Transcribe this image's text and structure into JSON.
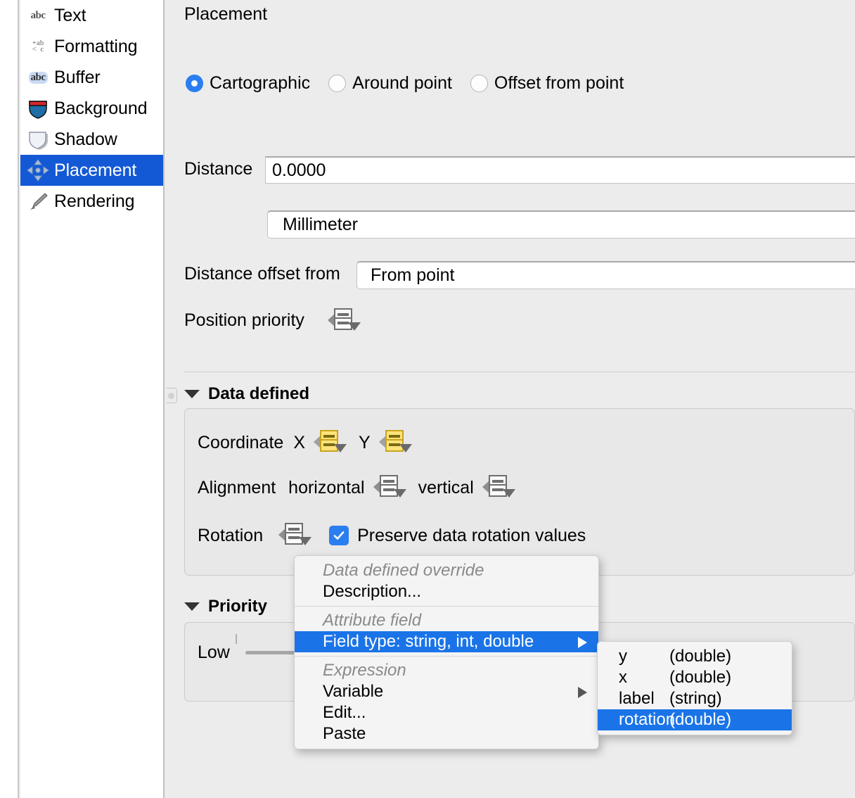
{
  "sidebar": {
    "items": [
      {
        "label": "Text",
        "icon": "abc-text-icon",
        "selected": false
      },
      {
        "label": "Formatting",
        "icon": "formatting-icon",
        "selected": false
      },
      {
        "label": "Buffer",
        "icon": "abc-buffer-icon",
        "selected": false
      },
      {
        "label": "Background",
        "icon": "background-icon",
        "selected": false
      },
      {
        "label": "Shadow",
        "icon": "shadow-icon",
        "selected": false
      },
      {
        "label": "Placement",
        "icon": "placement-icon",
        "selected": true
      },
      {
        "label": "Rendering",
        "icon": "rendering-icon",
        "selected": false
      }
    ]
  },
  "panel": {
    "title": "Placement",
    "placement_modes": [
      {
        "label": "Cartographic",
        "checked": true
      },
      {
        "label": "Around point",
        "checked": false
      },
      {
        "label": "Offset from point",
        "checked": false
      }
    ],
    "distance": {
      "label": "Distance",
      "value": "0.0000"
    },
    "units": {
      "value": "Millimeter"
    },
    "distance_offset_from": {
      "label": "Distance offset from",
      "value": "From point"
    },
    "position_priority": {
      "label": "Position priority"
    }
  },
  "data_defined": {
    "title": "Data defined",
    "coordinate": {
      "label": "Coordinate",
      "x_label": "X",
      "y_label": "Y"
    },
    "alignment": {
      "label": "Alignment",
      "horizontal_label": "horizontal",
      "vertical_label": "vertical"
    },
    "rotation": {
      "label": "Rotation",
      "preserve_label": "Preserve data rotation values",
      "preserve_checked": true
    }
  },
  "priority": {
    "title": "Priority",
    "low_label": "Low"
  },
  "context_menu": {
    "sections": [
      {
        "header": "Data defined override",
        "items": [
          {
            "label": "Description...",
            "selected": false,
            "submenu": false
          }
        ]
      },
      {
        "header": "Attribute field",
        "items": [
          {
            "label": "Field type: string, int, double",
            "selected": true,
            "submenu": true
          }
        ]
      },
      {
        "header": "Expression",
        "items": [
          {
            "label": "Variable",
            "selected": false,
            "submenu": true
          },
          {
            "label": "Edit...",
            "selected": false,
            "submenu": false
          },
          {
            "label": "Paste",
            "selected": false,
            "submenu": false
          }
        ]
      }
    ]
  },
  "field_submenu": {
    "items": [
      {
        "name": "y",
        "type": "(double)",
        "selected": false
      },
      {
        "name": "x",
        "type": "(double)",
        "selected": false
      },
      {
        "name": "label",
        "type": "(string)",
        "selected": false
      },
      {
        "name": "rotation",
        "type": "(double)",
        "selected": true
      }
    ]
  },
  "colors": {
    "accent": "#1359d6",
    "menu_highlight": "#1a74e8",
    "radio_on": "#2b7ef0",
    "checkbox": "#2b7ef0",
    "panel_bg": "#ececec",
    "active_override": "#ffe37a"
  }
}
